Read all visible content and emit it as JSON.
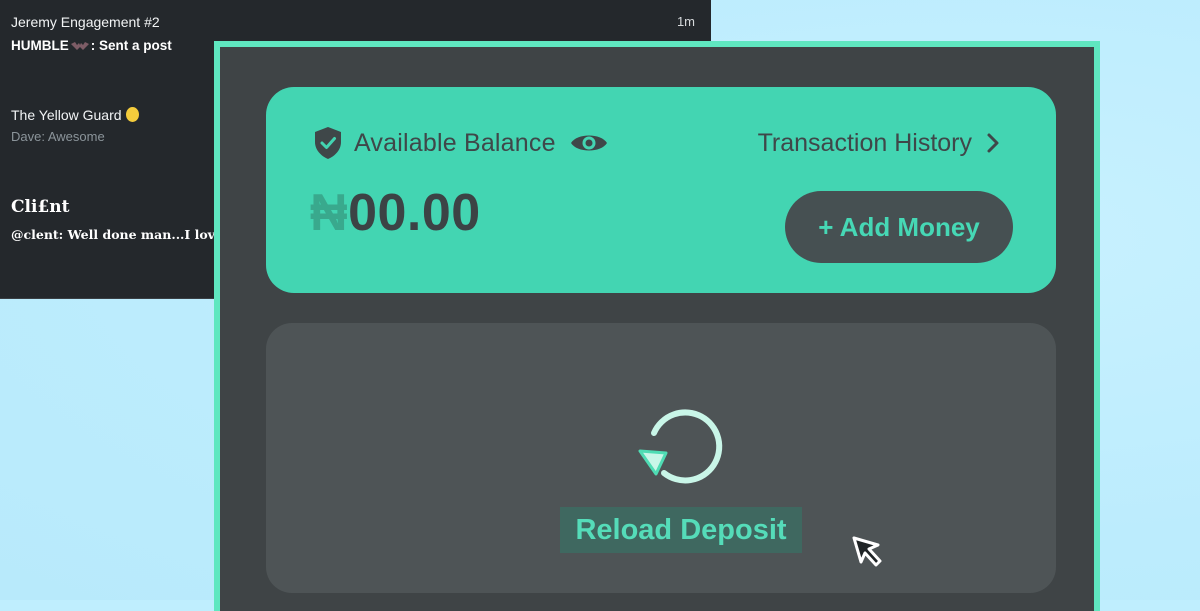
{
  "chat_list": {
    "items": [
      {
        "title": "Jeremy Engagement #2",
        "preview": "HUMBLE",
        "preview_suffix": ": Sent a post",
        "time": "1m"
      },
      {
        "title": "The Yellow Guard",
        "preview": "Dave: Awesome"
      },
      {
        "title": "Cli£nt",
        "preview": "@clent: Well done man...I love it"
      }
    ]
  },
  "wallet": {
    "balance_label": "Available Balance",
    "transaction_history_label": "Transaction History",
    "currency_symbol": "₦",
    "amount": "00.00",
    "add_money_label": "+ Add Money",
    "reload_label": "Reload Deposit"
  },
  "colors": {
    "accent": "#43d5b2",
    "frame_border": "#5fe7c0",
    "panel_dark": "#3f4446",
    "reload_text": "#55dcb9"
  },
  "icons": {
    "balance": "shield-check-icon",
    "visibility": "eye-icon",
    "history": "chevron-right-icon",
    "reload": "refresh-icon",
    "pointer": "mouse-cursor-icon"
  }
}
